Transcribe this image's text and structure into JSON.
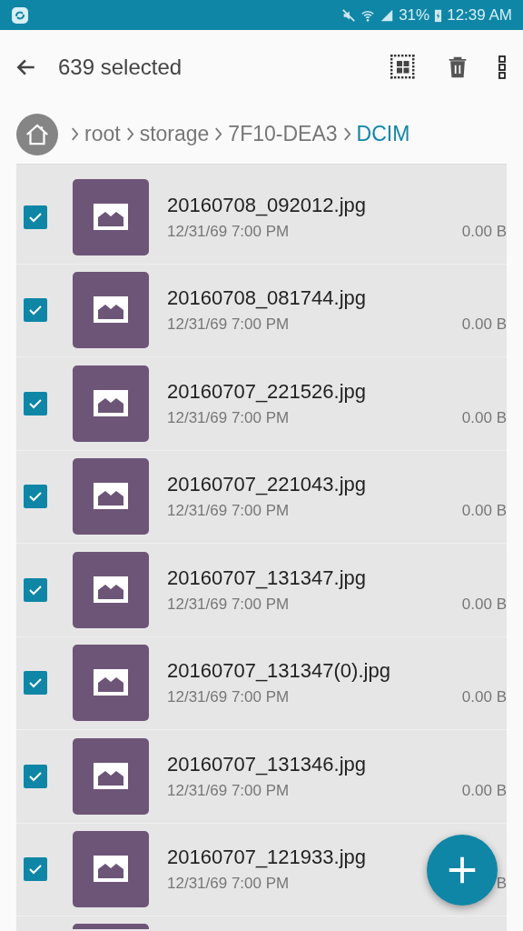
{
  "status_bar": {
    "battery": "31%",
    "time": "12:39 AM"
  },
  "toolbar": {
    "title": "639 selected"
  },
  "breadcrumb": [
    "root",
    "storage",
    "7F10-DEA3",
    "DCIM"
  ],
  "files": [
    {
      "kind": "file",
      "name": "20160708_092012.jpg",
      "date": "12/31/69 7:00 PM",
      "size": "0.00 B",
      "selected": true
    },
    {
      "kind": "file",
      "name": "20160708_081744.jpg",
      "date": "12/31/69 7:00 PM",
      "size": "0.00 B",
      "selected": true
    },
    {
      "kind": "file",
      "name": "20160707_221526.jpg",
      "date": "12/31/69 7:00 PM",
      "size": "0.00 B",
      "selected": true
    },
    {
      "kind": "file",
      "name": "20160707_221043.jpg",
      "date": "12/31/69 7:00 PM",
      "size": "0.00 B",
      "selected": true
    },
    {
      "kind": "file",
      "name": "20160707_131347.jpg",
      "date": "12/31/69 7:00 PM",
      "size": "0.00 B",
      "selected": true
    },
    {
      "kind": "file",
      "name": "20160707_131347(0).jpg",
      "date": "12/31/69 7:00 PM",
      "size": "0.00 B",
      "selected": true
    },
    {
      "kind": "file",
      "name": "20160707_131346.jpg",
      "date": "12/31/69 7:00 PM",
      "size": "0.00 B",
      "selected": true
    },
    {
      "kind": "file",
      "name": "20160707_121933.jpg",
      "date": "12/31/69 7:00 PM",
      "size": "B",
      "selected": true
    },
    {
      "kind": "clipped"
    }
  ]
}
